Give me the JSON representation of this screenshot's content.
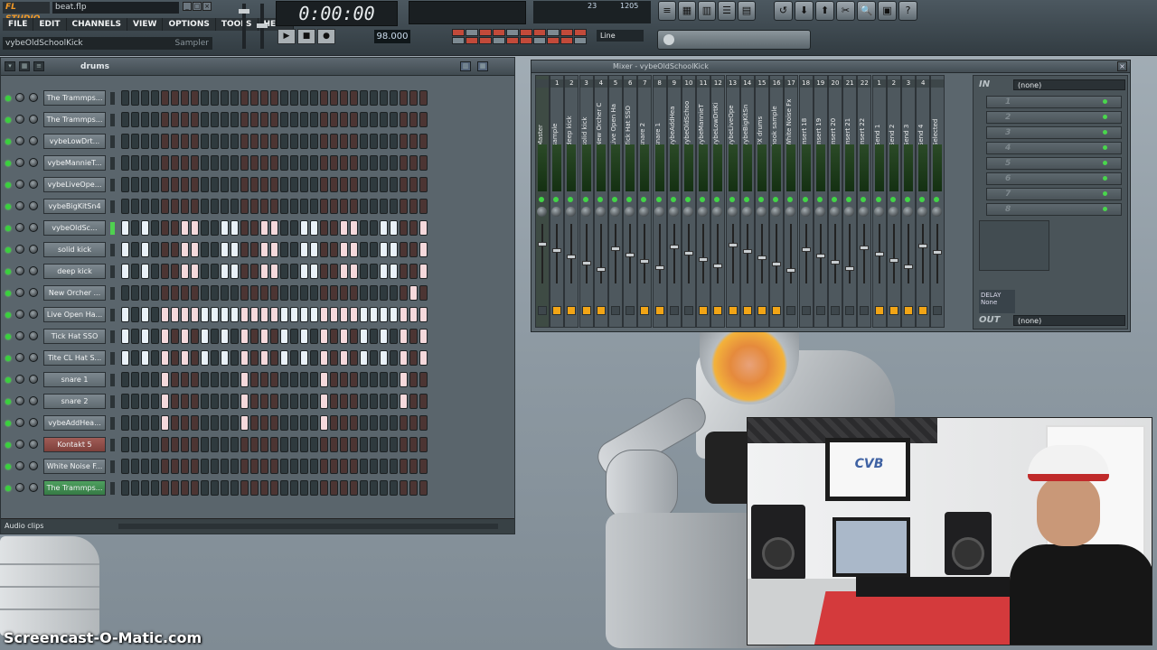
{
  "app": {
    "logo": "FL STUDIO",
    "file_name": "beat.flp",
    "menu": [
      "FILE",
      "EDIT",
      "CHANNELS",
      "VIEW",
      "OPTIONS",
      "TOOLS",
      "HELP"
    ],
    "hint_bar": "vybeOldSchoolKick",
    "hint_right": "Sampler",
    "time": "0:00:00",
    "cpu_value_1": "23",
    "cpu_value_2": "1205",
    "snap": "Line",
    "watermark": "Screencast-O-Matic.com"
  },
  "step_sequencer": {
    "pattern_name": "drums",
    "footer_label": "Audio clips",
    "channels": [
      {
        "name": "The Trammps...",
        "color": "grey",
        "steps": "0000000000000000000000000000000",
        "selected": false
      },
      {
        "name": "The Trammps...",
        "color": "grey",
        "steps": "0000000000000000000000000000000",
        "selected": false
      },
      {
        "name": "vybeLowDrt...",
        "color": "grey",
        "steps": "0000000000000000000000000000000",
        "selected": false
      },
      {
        "name": "vybeMannieT...",
        "color": "grey",
        "steps": "0000000000000000000000000000000",
        "selected": false
      },
      {
        "name": "vybeLiveOpe...",
        "color": "grey",
        "steps": "0000000000000000000000000000000",
        "selected": false
      },
      {
        "name": "vybeBigKitSn4",
        "color": "grey",
        "steps": "0000000000000000000000000000000",
        "selected": false
      },
      {
        "name": "vybeOldSc...",
        "color": "grey",
        "steps": "1010001100110011001100110011001",
        "selected": true
      },
      {
        "name": "solid kick",
        "color": "grey",
        "steps": "1010001100110011001100110011001",
        "selected": false
      },
      {
        "name": "deep kick",
        "color": "grey",
        "steps": "1010001100110011001100110011001",
        "selected": false
      },
      {
        "name": "New Orcher ...",
        "color": "grey",
        "steps": "0000000000000000000000000000010",
        "selected": false
      },
      {
        "name": "Live Open Ha...",
        "color": "grey",
        "steps": "1010111111111111111111111111111",
        "selected": false
      },
      {
        "name": "Tick Hat SSO",
        "color": "grey",
        "steps": "1010101010101010101010101010101",
        "selected": false
      },
      {
        "name": "Tite CL Hat S...",
        "color": "grey",
        "steps": "1010101010101010101010101010101",
        "selected": false
      },
      {
        "name": "snare 1",
        "color": "grey",
        "steps": "0000100000001000000010000000100",
        "selected": false
      },
      {
        "name": "snare 2",
        "color": "grey",
        "steps": "0000100000001000000010000000100",
        "selected": false
      },
      {
        "name": "vybeAddHea...",
        "color": "grey",
        "steps": "0000100000001000000010000000000",
        "selected": false
      },
      {
        "name": "Kontakt 5",
        "color": "red",
        "steps": "0000000000000000000000000000000",
        "selected": false
      },
      {
        "name": "White Noise F...",
        "color": "grey",
        "steps": "0000000000000000000000000000000",
        "selected": false
      },
      {
        "name": "The Trammps...",
        "color": "green",
        "steps": "0000000000000000000000000000000",
        "selected": false
      }
    ]
  },
  "mixer": {
    "title": "Mixer - vybeOldSchoolKick",
    "in_label": "IN",
    "out_label": "OUT",
    "in_value": "(none)",
    "out_value": "(none)",
    "fx_slots": [
      "1",
      "2",
      "3",
      "4",
      "5",
      "6",
      "7",
      "8"
    ],
    "delay_label": "DELAY",
    "delay_value": "None",
    "tracks": [
      {
        "num": "",
        "name": "Master",
        "route": false
      },
      {
        "num": "1",
        "name": "sample",
        "route": true
      },
      {
        "num": "2",
        "name": "deep kick",
        "route": true
      },
      {
        "num": "3",
        "name": "solid kick",
        "route": true
      },
      {
        "num": "4",
        "name": "New Orcher C",
        "route": true
      },
      {
        "num": "5",
        "name": "Live Open Ha",
        "route": false
      },
      {
        "num": "6",
        "name": "Tick Hat SSO",
        "route": false
      },
      {
        "num": "7",
        "name": "snare 2",
        "route": true
      },
      {
        "num": "8",
        "name": "snare 1",
        "route": true
      },
      {
        "num": "9",
        "name": "vybeAddHea",
        "route": false
      },
      {
        "num": "10",
        "name": "vybeOldSchoo",
        "route": false
      },
      {
        "num": "11",
        "name": "vybeMannieT",
        "route": true
      },
      {
        "num": "12",
        "name": "vybeLowDrtKi",
        "route": true
      },
      {
        "num": "13",
        "name": "vybeLiveOpe",
        "route": true
      },
      {
        "num": "14",
        "name": "vybeBigKitSn",
        "route": true
      },
      {
        "num": "15",
        "name": "FX drums",
        "route": true
      },
      {
        "num": "16",
        "name": "hook sample",
        "route": true
      },
      {
        "num": "17",
        "name": "White Noise Fx",
        "route": false
      },
      {
        "num": "18",
        "name": "Insert 18",
        "route": false
      },
      {
        "num": "19",
        "name": "Insert 19",
        "route": false
      },
      {
        "num": "20",
        "name": "Insert 20",
        "route": false
      },
      {
        "num": "21",
        "name": "Insert 21",
        "route": false
      },
      {
        "num": "22",
        "name": "Insert 22",
        "route": false
      },
      {
        "num": "1",
        "name": "Send 1",
        "route": true
      },
      {
        "num": "2",
        "name": "Send 2",
        "route": true
      },
      {
        "num": "3",
        "name": "Send 3",
        "route": true
      },
      {
        "num": "4",
        "name": "Send 4",
        "route": true
      },
      {
        "num": "",
        "name": "Selected",
        "route": false
      }
    ]
  },
  "webcam": {
    "monitor_logo": "CVB"
  },
  "colors": {
    "accent": "#f2a516",
    "led": "#39d13c",
    "step_on": "#e9f1f8",
    "step_on_alt": "#f5d9dc"
  }
}
